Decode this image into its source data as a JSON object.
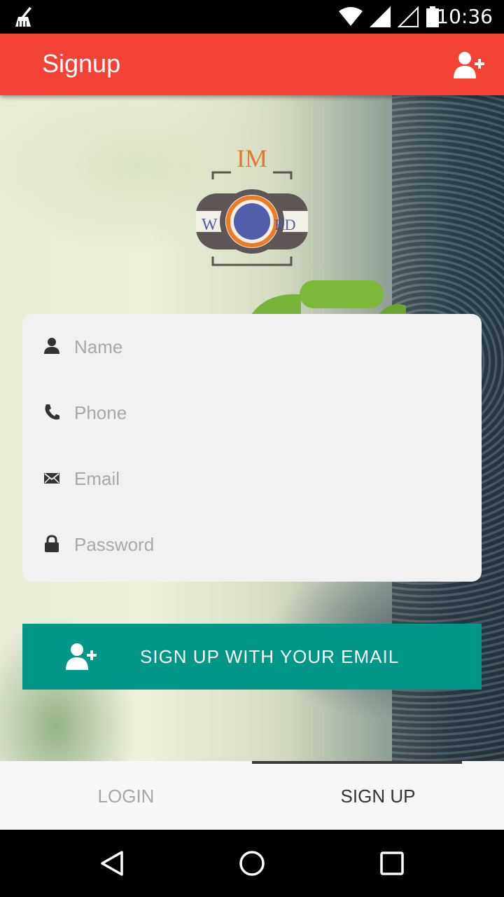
{
  "status_bar": {
    "time": "10:36",
    "icons": [
      "cleaner-icon",
      "wifi-icon",
      "signal-icon",
      "signal-empty-icon",
      "battery-icon"
    ]
  },
  "app_bar": {
    "title": "Signup",
    "action_icon": "add-user-icon",
    "color": "#f44336"
  },
  "logo": {
    "top_text": "IM",
    "middle_text_left": "W",
    "middle_text_right": "RD"
  },
  "form": {
    "fields": [
      {
        "icon": "person-icon",
        "placeholder": "Name"
      },
      {
        "icon": "phone-icon",
        "placeholder": "Phone"
      },
      {
        "icon": "email-icon",
        "placeholder": "Email"
      },
      {
        "icon": "lock-icon",
        "placeholder": "Password"
      }
    ]
  },
  "signup_button": {
    "label": "SIGN UP WITH YOUR EMAIL",
    "icon": "add-user-icon",
    "color": "#009688"
  },
  "tabs": [
    {
      "label": "LOGIN",
      "active": false
    },
    {
      "label": "SIGN UP",
      "active": true
    }
  ],
  "nav_bar": {
    "buttons": [
      "back-icon",
      "home-icon",
      "recents-icon"
    ]
  }
}
